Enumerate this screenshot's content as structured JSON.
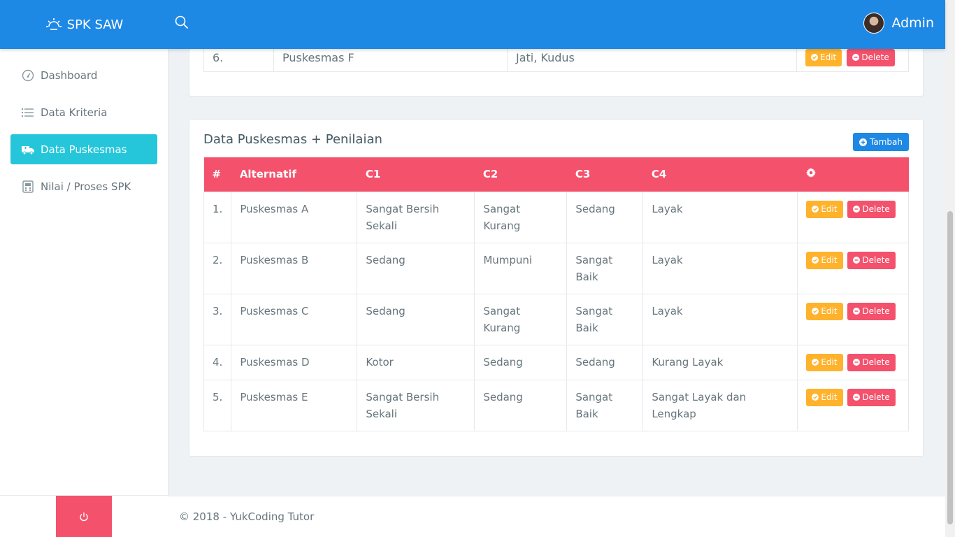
{
  "brand": {
    "title": "SPK SAW",
    "icon": "sun-logo-icon"
  },
  "header": {
    "user_name": "Admin",
    "search_icon": "search-icon"
  },
  "colors": {
    "primary": "#1e88e5",
    "accent_cyan": "#26c6da",
    "danger": "#f4516c",
    "warning": "#ffb22b"
  },
  "sidebar": {
    "items": [
      {
        "label": "Dashboard",
        "icon": "gauge-icon",
        "active": false
      },
      {
        "label": "Data Kriteria",
        "icon": "list-icon",
        "active": false
      },
      {
        "label": "Data Puskesmas",
        "icon": "ambulance-icon",
        "active": true
      },
      {
        "label": "Nilai / Proses SPK",
        "icon": "calculator-icon",
        "active": false
      }
    ],
    "power_icon": "power-icon"
  },
  "top_table": {
    "row": {
      "no": "6.",
      "name": "Puskesmas F",
      "address": "Jati, Kudus",
      "edit": "Edit",
      "delete": "Delete"
    }
  },
  "main": {
    "title": "Data Puskesmas + Penilaian",
    "add_button": "Tambah",
    "headers": {
      "no": "#",
      "alternatif": "Alternatif",
      "c1": "C1",
      "c2": "C2",
      "c3": "C3",
      "c4": "C4",
      "settings_icon": "gear-icon"
    },
    "rows": [
      {
        "no": "1.",
        "alternatif": "Puskesmas A",
        "c1": "Sangat Bersih Sekali",
        "c2": "Sangat Kurang",
        "c3": "Sedang",
        "c4": "Layak",
        "edit": "Edit",
        "delete": "Delete"
      },
      {
        "no": "2.",
        "alternatif": "Puskesmas B",
        "c1": "Sedang",
        "c2": "Mumpuni",
        "c3": "Sangat Baik",
        "c4": "Layak",
        "edit": "Edit",
        "delete": "Delete"
      },
      {
        "no": "3.",
        "alternatif": "Puskesmas C",
        "c1": "Sedang",
        "c2": "Sangat Kurang",
        "c3": "Sangat Baik",
        "c4": "Layak",
        "edit": "Edit",
        "delete": "Delete"
      },
      {
        "no": "4.",
        "alternatif": "Puskesmas D",
        "c1": "Kotor",
        "c2": "Sedang",
        "c3": "Sedang",
        "c4": "Kurang Layak",
        "edit": "Edit",
        "delete": "Delete"
      },
      {
        "no": "5.",
        "alternatif": "Puskesmas E",
        "c1": "Sangat Bersih Sekali",
        "c2": "Sedang",
        "c3": "Sangat Baik",
        "c4": "Sangat Layak dan Lengkap",
        "edit": "Edit",
        "delete": "Delete"
      }
    ]
  },
  "footer": {
    "text": "© 2018 - YukCoding Tutor"
  }
}
